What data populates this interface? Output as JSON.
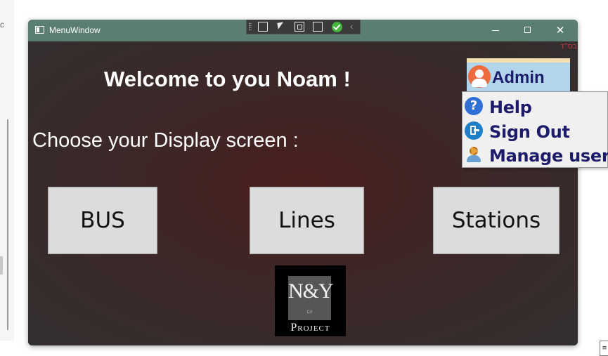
{
  "window": {
    "title": "MenuWindow",
    "controls": {
      "minimize": "—",
      "maximize": "☐",
      "close": "✕"
    }
  },
  "header": {
    "corner_mark": "בס\"ד",
    "welcome": "Welcome to you Noam !",
    "prompt": "Choose your Display screen :"
  },
  "display_buttons": [
    {
      "label": "BUS"
    },
    {
      "label": "Lines"
    },
    {
      "label": "Stations"
    }
  ],
  "logo": {
    "initials": "N&Y",
    "subtitle": "C#",
    "word": "Project"
  },
  "user_menu": {
    "role": "Admin",
    "items": [
      {
        "label": "Help",
        "icon": "help-icon"
      },
      {
        "label": "Sign Out",
        "icon": "sign-out-icon"
      },
      {
        "label": "Manage users",
        "icon": "manage-users-icon"
      }
    ]
  },
  "colors": {
    "titlebar": "#5b7e72",
    "background": "#3d2f2e",
    "menu_text": "#1d1c6a",
    "admin_header": "#b3d5ec"
  }
}
